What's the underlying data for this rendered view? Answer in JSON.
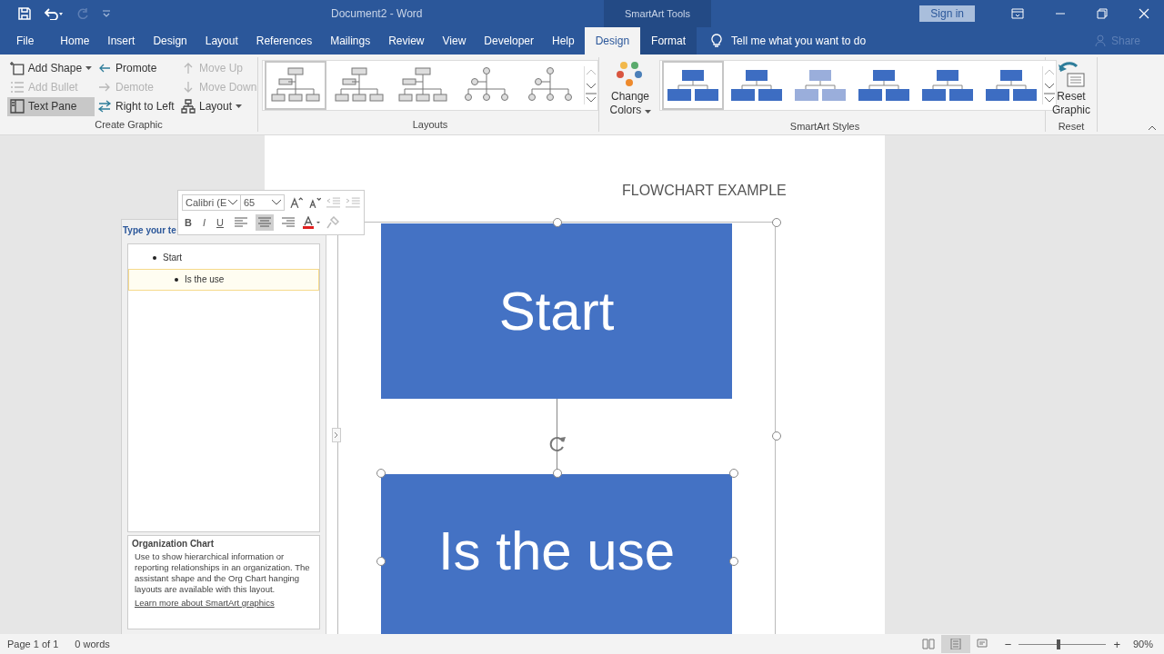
{
  "window": {
    "title": "Document2  -  Word",
    "context_label": "SmartArt Tools",
    "sign_in": "Sign in"
  },
  "tabs": [
    {
      "label": "File",
      "selected": false,
      "kind": "file"
    },
    {
      "label": "Home",
      "selected": false,
      "kind": "main"
    },
    {
      "label": "Insert",
      "selected": false,
      "kind": "main"
    },
    {
      "label": "Design",
      "selected": false,
      "kind": "main"
    },
    {
      "label": "Layout",
      "selected": false,
      "kind": "main"
    },
    {
      "label": "References",
      "selected": false,
      "kind": "main"
    },
    {
      "label": "Mailings",
      "selected": false,
      "kind": "main"
    },
    {
      "label": "Review",
      "selected": false,
      "kind": "main"
    },
    {
      "label": "View",
      "selected": false,
      "kind": "main"
    },
    {
      "label": "Developer",
      "selected": false,
      "kind": "main"
    },
    {
      "label": "Help",
      "selected": false,
      "kind": "main"
    },
    {
      "label": "Design",
      "selected": true,
      "kind": "context"
    },
    {
      "label": "Format",
      "selected": false,
      "kind": "context"
    }
  ],
  "tell_me": "Tell me what you want to do",
  "share": "Share",
  "ribbon": {
    "create_graphic": {
      "label": "Create Graphic",
      "buttons": [
        {
          "label": "Add Shape",
          "disabled": false,
          "selected": false,
          "dropdown": true
        },
        {
          "label": "Add Bullet",
          "disabled": true,
          "selected": false,
          "dropdown": false
        },
        {
          "label": "Text Pane",
          "disabled": false,
          "selected": true,
          "dropdown": false
        },
        {
          "label": "Promote",
          "disabled": false,
          "selected": false,
          "dropdown": false
        },
        {
          "label": "Demote",
          "disabled": true,
          "selected": false,
          "dropdown": false
        },
        {
          "label": "Right to Left",
          "disabled": false,
          "selected": false,
          "dropdown": false
        },
        {
          "label": "Move Up",
          "disabled": true,
          "selected": false,
          "dropdown": false
        },
        {
          "label": "Move Down",
          "disabled": true,
          "selected": false,
          "dropdown": false
        },
        {
          "label": "Layout",
          "disabled": false,
          "selected": false,
          "dropdown": true
        }
      ]
    },
    "layouts": {
      "label": "Layouts",
      "items": [
        {
          "selected": true
        },
        {
          "selected": false
        },
        {
          "selected": false
        },
        {
          "selected": false
        },
        {
          "selected": false
        }
      ]
    },
    "change_colors": {
      "label": "Change Colors"
    },
    "styles": {
      "label": "SmartArt Styles",
      "items": [
        {
          "selected": true
        },
        {
          "selected": false
        },
        {
          "selected": false
        },
        {
          "selected": false
        },
        {
          "selected": false
        },
        {
          "selected": false
        }
      ]
    },
    "reset": {
      "button": "Reset Graphic",
      "label": "Reset"
    }
  },
  "mini_toolbar": {
    "font": "Calibri (E",
    "size": "65",
    "bold": "B",
    "italic": "I",
    "underline": "U",
    "align": [
      {
        "selected": false
      },
      {
        "selected": true
      },
      {
        "selected": false
      }
    ]
  },
  "text_pane": {
    "title": "Type your te",
    "items": [
      {
        "text": "Start",
        "selected": false,
        "children": [
          {
            "text": "Is the use",
            "selected": true
          }
        ]
      }
    ],
    "info_title": "Organization Chart",
    "info_text": "Use to show hierarchical information or reporting relationships in an organization. The assistant shape and the Org Chart hanging layouts are available with this layout.",
    "info_link": "Learn more about SmartArt graphics"
  },
  "document": {
    "header": "FLOWCHART EXAMPLE",
    "shapes": [
      "Start",
      "Is the use"
    ]
  },
  "status_bar": {
    "page": "Page 1 of 1",
    "words": "0 words",
    "views": [
      {
        "selected": false
      },
      {
        "selected": true
      },
      {
        "selected": false
      }
    ],
    "zoom_out": "−",
    "zoom_in": "+",
    "zoom": {
      "level": 0.45
    },
    "zoom_text": "90%"
  }
}
